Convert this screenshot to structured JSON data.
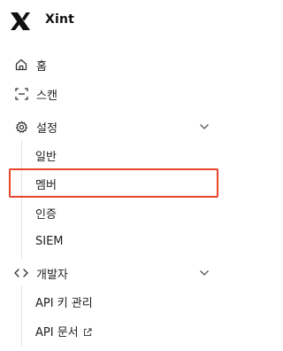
{
  "brand": {
    "name": "Xint",
    "logo_icon": "x-logo-icon"
  },
  "nav": {
    "home": {
      "label": "홈",
      "icon": "home-icon"
    },
    "scan": {
      "label": "스캔",
      "icon": "scan-icon"
    },
    "settings": {
      "label": "설정",
      "icon": "gear-icon",
      "expanded": true,
      "items": [
        {
          "label": "일반"
        },
        {
          "label": "멤버",
          "highlighted": true
        },
        {
          "label": "인증"
        },
        {
          "label": "SIEM"
        }
      ]
    },
    "developer": {
      "label": "개발자",
      "icon": "code-icon",
      "expanded": true,
      "items": [
        {
          "label": "API 키 관리"
        },
        {
          "label": "API 문서",
          "icon": "external-link-icon"
        }
      ]
    }
  },
  "colors": {
    "highlight": "#e8452c",
    "text": "#1f1f1f",
    "rail": "#e1e1e1"
  }
}
